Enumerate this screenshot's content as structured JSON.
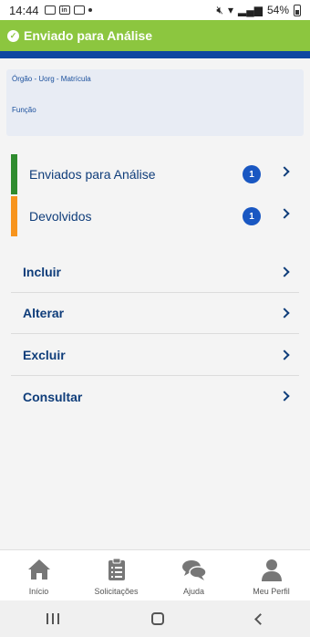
{
  "status_bar": {
    "time": "14:44",
    "battery": "54%"
  },
  "toast": {
    "message": "Enviado para Análise",
    "color": "#8cc63f"
  },
  "info": {
    "line1": "Órgão - Uorg - Matrícula",
    "line2": "Função"
  },
  "status_items": [
    {
      "label": "Enviados para Análise",
      "count": "1",
      "color": "#2e8b2e"
    },
    {
      "label": "Devolvidos",
      "count": "1",
      "color": "#f7941d"
    }
  ],
  "actions": [
    {
      "label": "Incluir"
    },
    {
      "label": "Alterar"
    },
    {
      "label": "Excluir"
    },
    {
      "label": "Consultar"
    }
  ],
  "bottom_nav": [
    {
      "label": "Início",
      "icon": "home-icon"
    },
    {
      "label": "Solicitações",
      "icon": "clipboard-icon"
    },
    {
      "label": "Ajuda",
      "icon": "chat-icon"
    },
    {
      "label": "Meu Perfil",
      "icon": "user-icon"
    }
  ]
}
